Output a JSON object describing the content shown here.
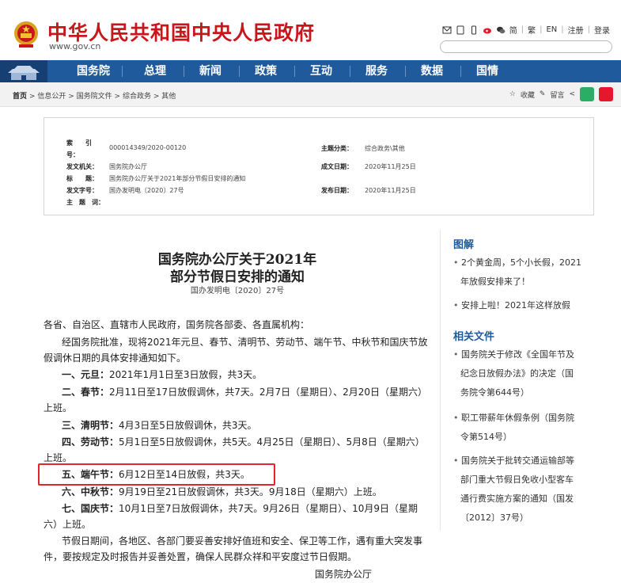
{
  "header": {
    "title": "中华人民共和国中央人民政府",
    "url": "www.gov.cn",
    "links": [
      "简",
      "繁",
      "EN",
      "注册",
      "登录"
    ]
  },
  "nav": {
    "items": [
      "国务院",
      "总理",
      "新闻",
      "政策",
      "互动",
      "服务",
      "数据",
      "国情"
    ]
  },
  "breadcrumb": {
    "home": "首页",
    "path": [
      "信息公开",
      "国务院文件",
      "综合政务",
      "其他"
    ],
    "sep": ">",
    "tools": [
      "收藏",
      "留言"
    ]
  },
  "meta": {
    "index_label": "索　　引　　号：",
    "index_label_1": "索　　引",
    "index_label_2": "号：",
    "index_value": "000014349/2020-00120",
    "category_label": "主题分类：",
    "category_value": "综合政务\\其他",
    "issuer_label": "发文机关：",
    "issuer_value": "国务院办公厅",
    "date_label": "成文日期：",
    "date_value": "2020年11月25日",
    "title_label": "标　　题：",
    "title_value": "国务院办公厅关于2021年部分节假日安排的通知",
    "docno_label": "发文字号：",
    "docno_value": "国办发明电〔2020〕27号",
    "publish_label": "发布日期：",
    "publish_value": "2020年11月25日",
    "subject_label": "主　题　词："
  },
  "article": {
    "title_line1": "国务院办公厅关于2021年",
    "title_line2": "部分节假日安排的通知",
    "doc_no": "国办发明电〔2020〕27号",
    "salutation": "各省、自治区、直辖市人民政府，国务院各部委、各直属机构：",
    "intro_1": "经国务院批准，现将2021年元旦、春节、清明节、劳动节、端午节、中秋节和国庆节放",
    "intro_2": "假调休日期的具体安排通知如下。",
    "item1_head": "一、元旦：",
    "item1_text": "2021年1月1日至3日放假，共3天。",
    "item2_head": "二、春节：",
    "item2_text": "2月11日至17日放假调休，共7天。2月7日（星期日）、2月20日（星期六）",
    "item2_text2": "上班。",
    "item3_head": "三、清明节：",
    "item3_text": "4月3日至5日放假调休，共3天。",
    "item4_head": "四、劳动节：",
    "item4_text": "5月1日至5日放假调休，共5天。4月25日（星期日）、5月8日（星期六）",
    "item4_text2": "上班。",
    "item5_head": "五、端午节：",
    "item5_text": "6月12日至14日放假，共3天。",
    "item6_head": "六、中秋节：",
    "item6_text": "9月19日至21日放假调休，共3天。9月18日（星期六）上班。",
    "item7_head": "七、国庆节：",
    "item7_text": "10月1日至7日放假调休，共7天。9月26日（星期日）、10月9日（星期",
    "item7_text2": "六）上班。",
    "closing_1": "节假日期间，各地区、各部门要妥善安排好值班和安全、保卫等工作，遇有重大突发事",
    "closing_2": "件，要按规定及时报告并妥善处置，确保人民群众祥和平安度过节日假期。",
    "signature": "国务院办公厅"
  },
  "sidebar": {
    "section1_title": "图解",
    "section1_items": [
      [
        "2个黄金周，5个小长假，2021",
        "年放假安排来了！"
      ],
      [
        "安排上啦！2021年这样放假"
      ]
    ],
    "section2_title": "相关文件",
    "section2_items": [
      [
        "国务院关于修改《全国年节及",
        "纪念日放假办法》的决定（国",
        "务院令第644号）"
      ],
      [
        "职工带薪年休假条例（国务院",
        "令第514号）"
      ],
      [
        "国务院关于批转交通运输部等",
        "部门重大节假日免收小型客车",
        "通行费实施方案的通知（国发",
        "〔2012〕37号）"
      ]
    ]
  },
  "colors": {
    "brand_red": "#c8161d",
    "nav_blue": "#1f5a9d",
    "highlight": "#e0262b"
  }
}
